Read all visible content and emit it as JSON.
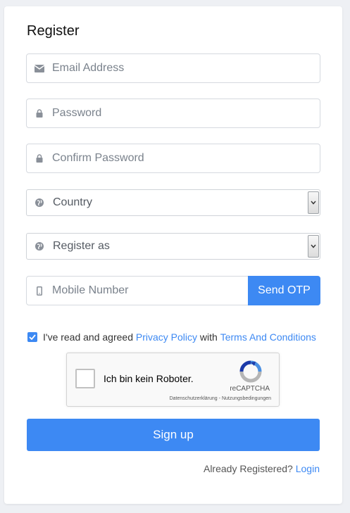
{
  "form": {
    "title": "Register",
    "email": {
      "placeholder": "Email Address",
      "icon": "envelope-icon"
    },
    "password": {
      "placeholder": "Password",
      "icon": "lock-icon"
    },
    "confirm_password": {
      "placeholder": "Confirm Password",
      "icon": "lock-icon"
    },
    "country": {
      "selected": "Country",
      "icon": "globe-icon"
    },
    "register_as": {
      "selected": "Register as",
      "icon": "globe-icon"
    },
    "mobile": {
      "placeholder": "Mobile Number",
      "icon": "mobile-phone-icon"
    },
    "send_otp_label": "Send OTP",
    "agree": {
      "checked": true,
      "prefix": "I've read and agreed",
      "privacy_link": "Privacy Policy",
      "middle": "with",
      "terms_link": "Terms And Conditions"
    },
    "captcha": {
      "label": "Ich bin kein Roboter.",
      "brand": "reCAPTCHA",
      "privacy": "Datenschutzerklärung",
      "separator": "-",
      "terms": "Nutzungsbedingungen"
    },
    "signup_label": "Sign up",
    "already_registered": "Already Registered?",
    "login_link": "Login"
  },
  "colors": {
    "accent": "#3d89f3",
    "background": "#eef0f4",
    "card": "#ffffff"
  }
}
